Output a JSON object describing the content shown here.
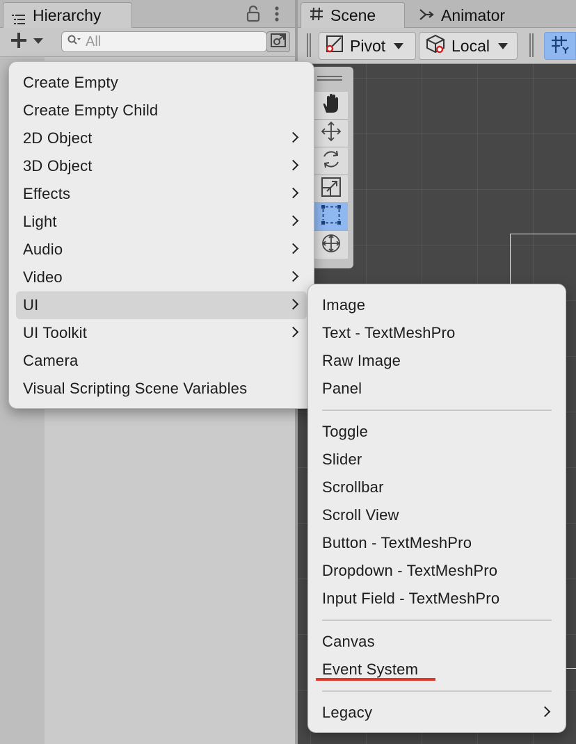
{
  "hierarchy": {
    "tab_title": "Hierarchy",
    "search": {
      "placeholder": "All",
      "value": ""
    }
  },
  "scene": {
    "tab_title": "Scene",
    "animator_tab_title": "Animator",
    "pivot_label": "Pivot",
    "space_label": "Local"
  },
  "tools": [
    "hand-tool",
    "move-tool",
    "rotate-tool",
    "scale-tool",
    "rect-tool",
    "transform-tool"
  ],
  "active_tool": "rect-tool",
  "create_menu": {
    "items": [
      {
        "label": "Create Empty",
        "submenu": false
      },
      {
        "label": "Create Empty Child",
        "submenu": false
      },
      {
        "label": "2D Object",
        "submenu": true
      },
      {
        "label": "3D Object",
        "submenu": true
      },
      {
        "label": "Effects",
        "submenu": true
      },
      {
        "label": "Light",
        "submenu": true
      },
      {
        "label": "Audio",
        "submenu": true
      },
      {
        "label": "Video",
        "submenu": true
      },
      {
        "label": "UI",
        "submenu": true,
        "highlighted": true
      },
      {
        "label": "UI Toolkit",
        "submenu": true
      },
      {
        "label": "Camera",
        "submenu": false
      },
      {
        "label": "Visual Scripting Scene Variables",
        "submenu": false
      }
    ]
  },
  "ui_submenu": {
    "groups": [
      [
        "Image",
        "Text - TextMeshPro",
        "Raw Image",
        "Panel"
      ],
      [
        "Toggle",
        "Slider",
        "Scrollbar",
        "Scroll View",
        "Button - TextMeshPro",
        "Dropdown - TextMeshPro",
        "Input Field - TextMeshPro"
      ],
      [
        "Canvas",
        "Event System"
      ],
      [
        "Legacy"
      ]
    ],
    "underlined_item": "Event System",
    "underline_color": "#d9382b"
  },
  "colors": {
    "selected_tool_blue": "#8fb7f0",
    "scene_background": "#474747",
    "menu_background": "#ececec",
    "menu_highlight": "#d4d4d4"
  }
}
